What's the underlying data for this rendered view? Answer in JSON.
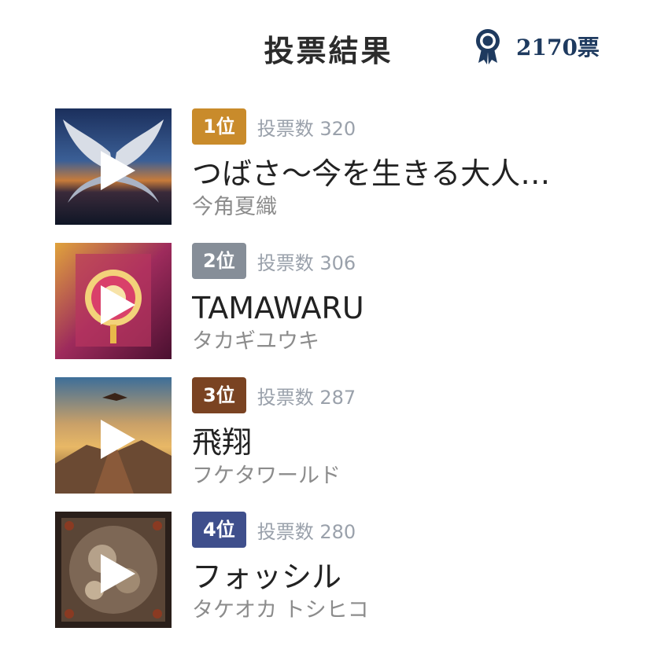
{
  "header": {
    "title": "投票結果",
    "total_votes": "2170票",
    "icon": "award-ribbon-icon"
  },
  "colors": {
    "gold": "#c98b2b",
    "silver": "#868e98",
    "bronze": "#7a4322",
    "fourth": "#3f4f8c"
  },
  "results": [
    {
      "rank": "1位",
      "votes": "投票数 320",
      "title": "つばさ〜今を生きる大人…",
      "artist": "今角夏織",
      "thumb": "wings-artwork"
    },
    {
      "rank": "2位",
      "votes": "投票数 306",
      "title": "TAMAWARU",
      "artist": "タカギユウキ",
      "thumb": "mandala-artwork"
    },
    {
      "rank": "3位",
      "votes": "投票数 287",
      "title": "飛翔",
      "artist": "フケタワールド",
      "thumb": "eagle-mountain-artwork"
    },
    {
      "rank": "4位",
      "votes": "投票数 280",
      "title": "フォッシル",
      "artist": "タケオカ トシヒコ",
      "thumb": "fossil-artwork"
    }
  ]
}
